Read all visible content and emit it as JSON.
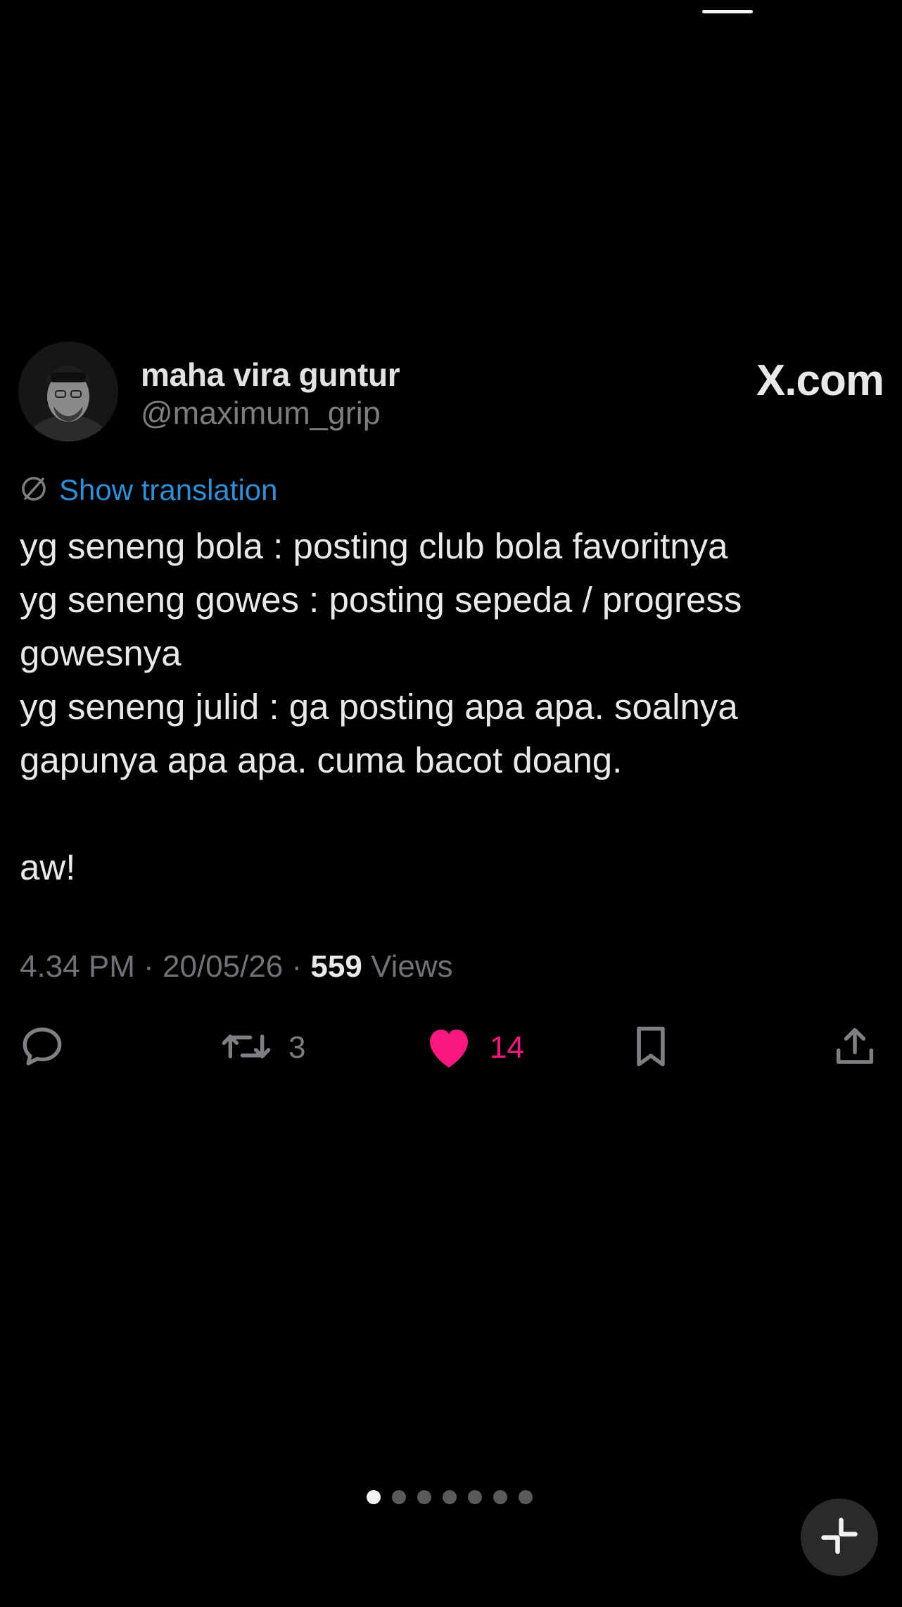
{
  "tweet": {
    "author_name": "maha vira guntur",
    "author_handle": "@maximum_grip",
    "brand_prefix": "X",
    "brand_suffix": ".com",
    "translate_label": "Show translation",
    "text": "yg seneng bola : posting club bola favoritnya\nyg seneng gowes : posting sepeda / progress gowesnya\nyg seneng julid : ga posting apa apa. soalnya gapunya apa apa. cuma bacot doang.\n\naw!",
    "time": "4.34 PM",
    "date": "20/05/26",
    "separator": "·",
    "views_count": "559",
    "views_label": "Views"
  },
  "actions": {
    "reply_icon": "reply-icon",
    "retweet_icon": "retweet-icon",
    "retweet_count": "3",
    "like_icon": "heart-icon",
    "like_count": "14",
    "bookmark_icon": "bookmark-icon",
    "share_icon": "share-icon"
  },
  "colors": {
    "background": "#000000",
    "link": "#2f8fd6",
    "like": "#f91880",
    "muted": "#7d7d7d"
  },
  "pager": {
    "total": 7,
    "active_index": 0
  }
}
